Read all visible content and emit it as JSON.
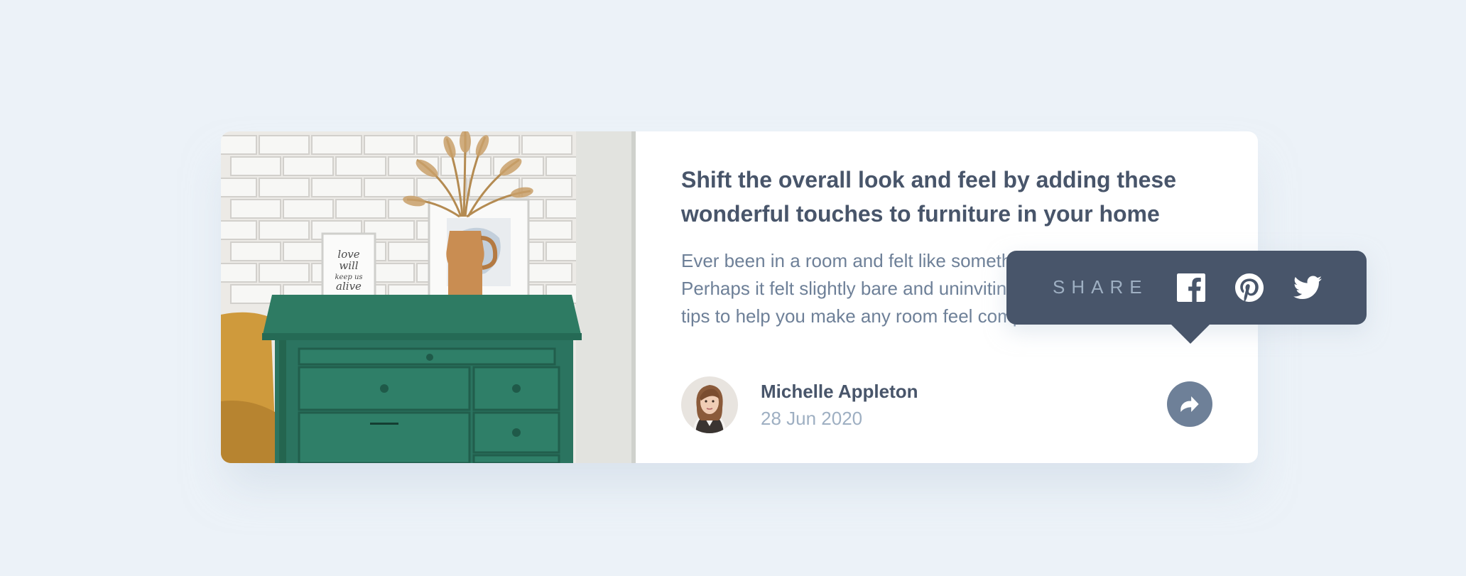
{
  "article": {
    "title": "Shift the overall look and feel by adding these wonderful touches to furniture in your home",
    "excerpt": "Ever been in a room and felt like something was missing? Perhaps it felt slightly bare and uninviting. I’ve got some simple tips to help you make any room feel complete."
  },
  "author": {
    "name": "Michelle Appleton",
    "date": "28 Jun 2020"
  },
  "share": {
    "label": "SHARE",
    "networks": [
      "facebook-icon",
      "pinterest-icon",
      "twitter-icon"
    ]
  },
  "image": {
    "frame_text": [
      "love",
      "will",
      "keep us",
      "alive"
    ]
  },
  "colors": {
    "background": "#ecf2f8",
    "dark_blue": "#48556a",
    "grayish_blue": "#6e8098",
    "light_grayish_blue": "#9eafc2",
    "card": "#ffffff"
  }
}
